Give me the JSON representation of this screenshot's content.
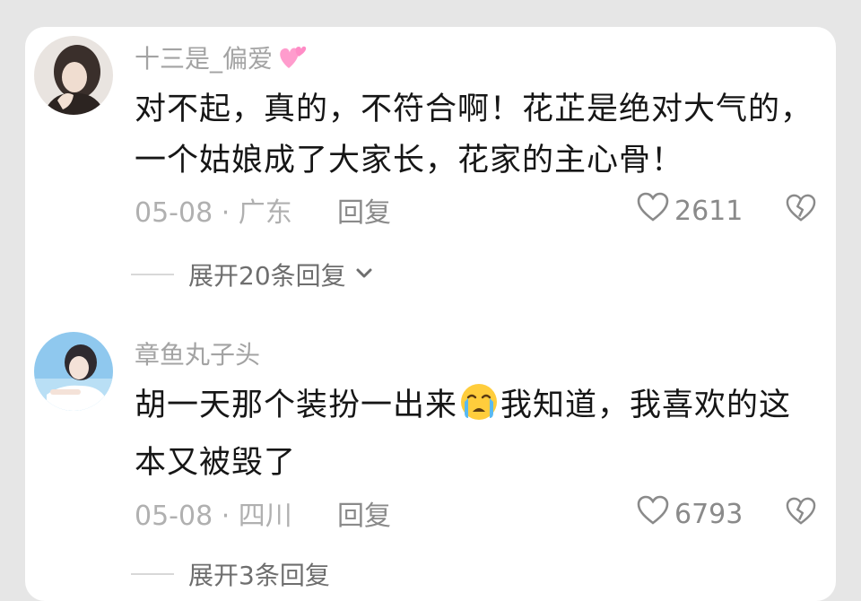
{
  "comments": [
    {
      "username": "十三是_偏爱",
      "username_emoji": "pink-hearts",
      "text_line1": "对不起，真的，不符合啊！花芷是绝对大气的，",
      "text_line2": "一个姑娘成了大家长，花家的主心骨！",
      "date": "05-08",
      "location": "广东",
      "reply_label": "回复",
      "likes": "2611",
      "expand_label": "展开20条回复"
    },
    {
      "username": "章鱼丸子头",
      "text_before_emoji": "胡一天那个装扮一出来",
      "text_emoji": "loudly-crying-face",
      "text_after_emoji": "我知道，我喜欢的这",
      "text_line2": "本又被毁了",
      "date": "05-08",
      "location": "四川",
      "reply_label": "回复",
      "likes": "6793",
      "expand_label": "展开3条回复"
    }
  ],
  "colors": {
    "background": "#e6e6e6",
    "card": "#ffffff",
    "text": "#161616",
    "meta": "#b0b0b0",
    "username": "#a3a3a3",
    "emoji_heart": "#ff8cc6"
  }
}
